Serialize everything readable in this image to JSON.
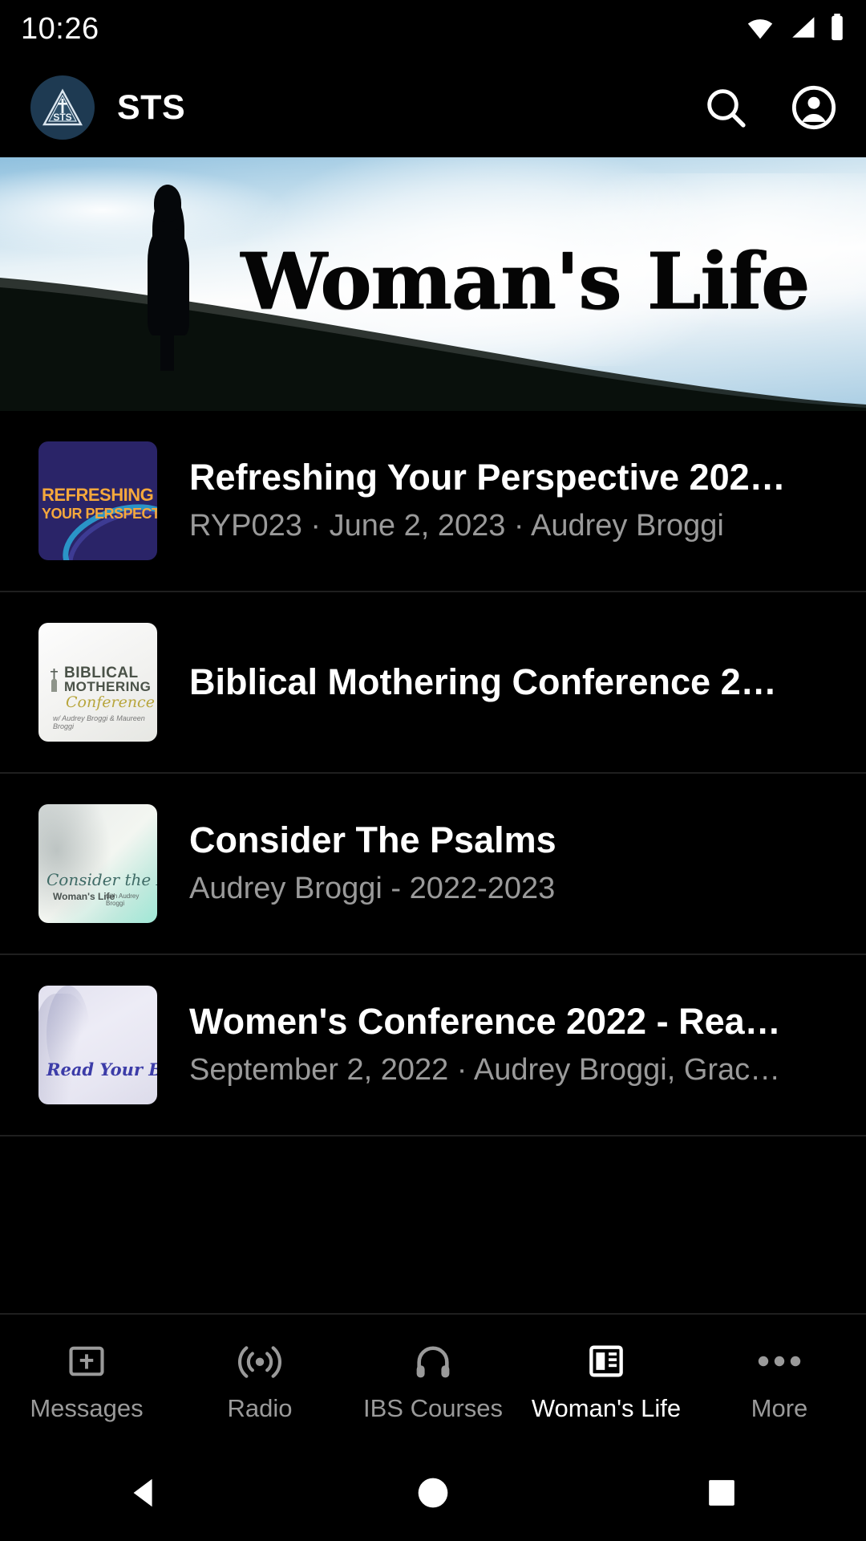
{
  "status_bar": {
    "time": "10:26",
    "icons": [
      "wifi-icon",
      "cellular-signal-icon",
      "battery-icon"
    ]
  },
  "app_bar": {
    "logo_icon": "sts-triangle-cross-logo",
    "logo_text": "STS",
    "title": "STS",
    "search_icon": "search-icon",
    "account_icon": "account-circle-icon",
    "background_color": "#000000"
  },
  "hero": {
    "title": "Woman's Life",
    "alt": "silhouette of woman standing on hill against bright sky"
  },
  "list": [
    {
      "title": "Refreshing Your Perspective 202…",
      "subtitle": "RYP023 · June 2, 2023 · Audrey Broggi",
      "thumb": {
        "style": "refreshing",
        "line1": "REFRESHING",
        "line2": "YOUR PERSPECTIVE",
        "bg": "#2a2468",
        "accent": "#f5a83c"
      }
    },
    {
      "title": "Biblical Mothering Conference 2…",
      "subtitle": "",
      "thumb": {
        "style": "biblical",
        "line1": "BIBLICAL",
        "line2": "MOTHERING",
        "line3": "Conference",
        "line4": "w/ Audrey Broggi & Maureen Broggi",
        "bg": "#fdfdfd",
        "accent": "#b8a63e"
      }
    },
    {
      "title": "Consider The Psalms",
      "subtitle": "Audrey Broggi - 2022-2023",
      "thumb": {
        "style": "psalms",
        "line1": "Consider the Psalms",
        "line2": "Woman's Life",
        "line3": "with Audrey Broggi",
        "bg": "#9fe8d6",
        "accent": "#3f6b66"
      }
    },
    {
      "title": "Women's Conference 2022 - Rea…",
      "subtitle": "September 2, 2022 · Audrey Broggi, Grac…",
      "thumb": {
        "style": "bible",
        "line1": "Read Your Bible!",
        "bg": "#e7e6f2",
        "accent": "#3c3ca8"
      }
    }
  ],
  "bottom_nav": {
    "items": [
      {
        "label": "Messages",
        "icon": "message-cross-icon",
        "active": false
      },
      {
        "label": "Radio",
        "icon": "radio-broadcast-icon",
        "active": false
      },
      {
        "label": "IBS Courses",
        "icon": "headphones-icon",
        "active": false
      },
      {
        "label": "Woman's Life",
        "icon": "news-article-icon",
        "active": true
      },
      {
        "label": "More",
        "icon": "more-dots-icon",
        "active": false
      }
    ],
    "active_color": "#ffffff",
    "inactive_color": "#9a9a9a"
  },
  "system_nav": {
    "back_icon": "back-triangle-icon",
    "home_icon": "home-circle-icon",
    "recents_icon": "recents-square-icon"
  }
}
